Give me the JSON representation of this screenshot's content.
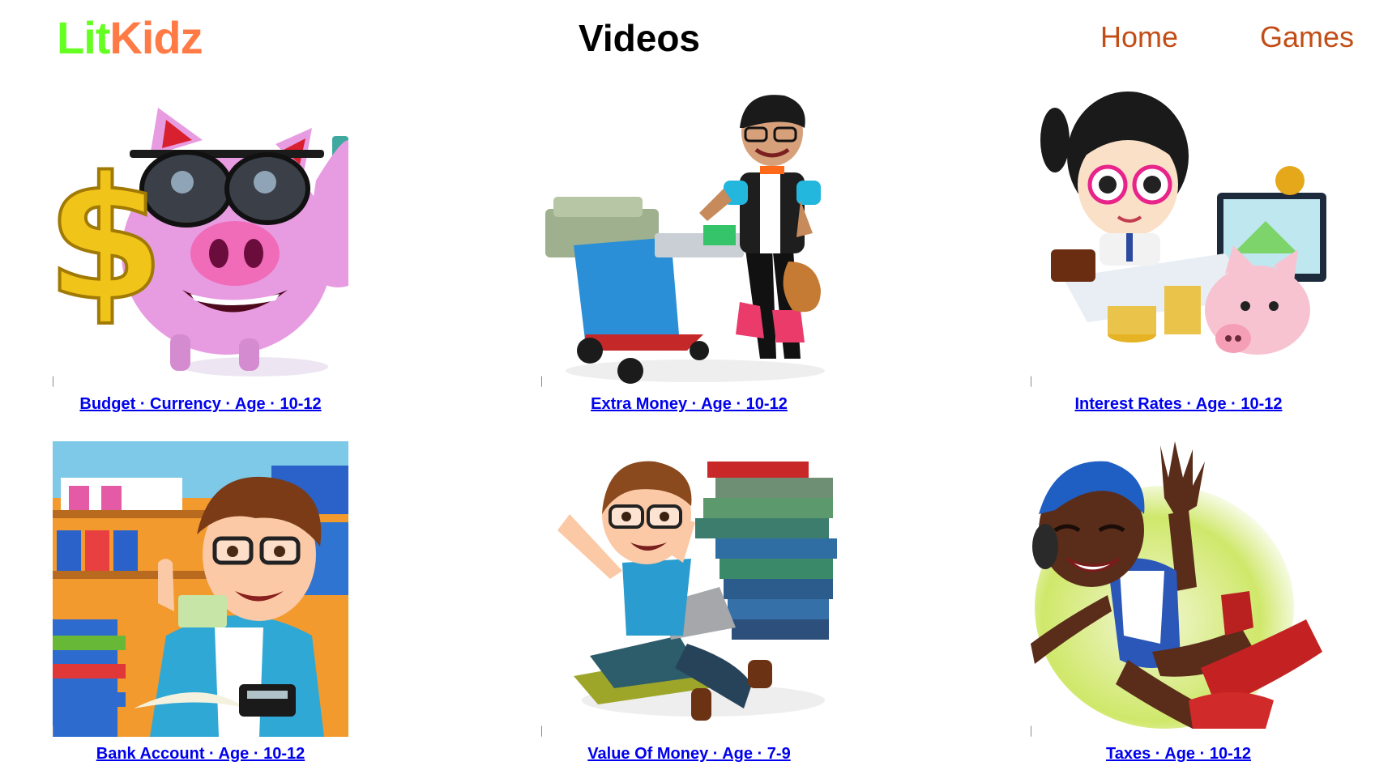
{
  "header": {
    "logo_part1": "Lit",
    "logo_part2": "Kidz",
    "title": "Videos",
    "nav": {
      "home": "Home",
      "games": "Games"
    }
  },
  "colors": {
    "logo_lit": "#66ff22",
    "logo_kidz": "#ff7a45",
    "nav_link": "#c24d16",
    "caption_link": "#0000ee"
  },
  "videos": [
    {
      "caption": "Budget · Currency · Age · 10-12",
      "icon": "piggy-bank-with-sunglasses-image"
    },
    {
      "caption": "Extra Money · Age · 10-12",
      "icon": "boy-with-money-cart-image"
    },
    {
      "caption": "Interest Rates · Age · 10-12",
      "icon": "girl-with-piggy-bank-and-laptop-image"
    },
    {
      "caption": "Bank Account · Age · 10-12",
      "icon": "boy-with-calculator-image"
    },
    {
      "caption": "Value Of Money · Age · 7-9",
      "icon": "boy-with-books-and-laptop-image"
    },
    {
      "caption": "Taxes · Age · 10-12",
      "icon": "jumping-boy-with-headphones-image"
    }
  ]
}
